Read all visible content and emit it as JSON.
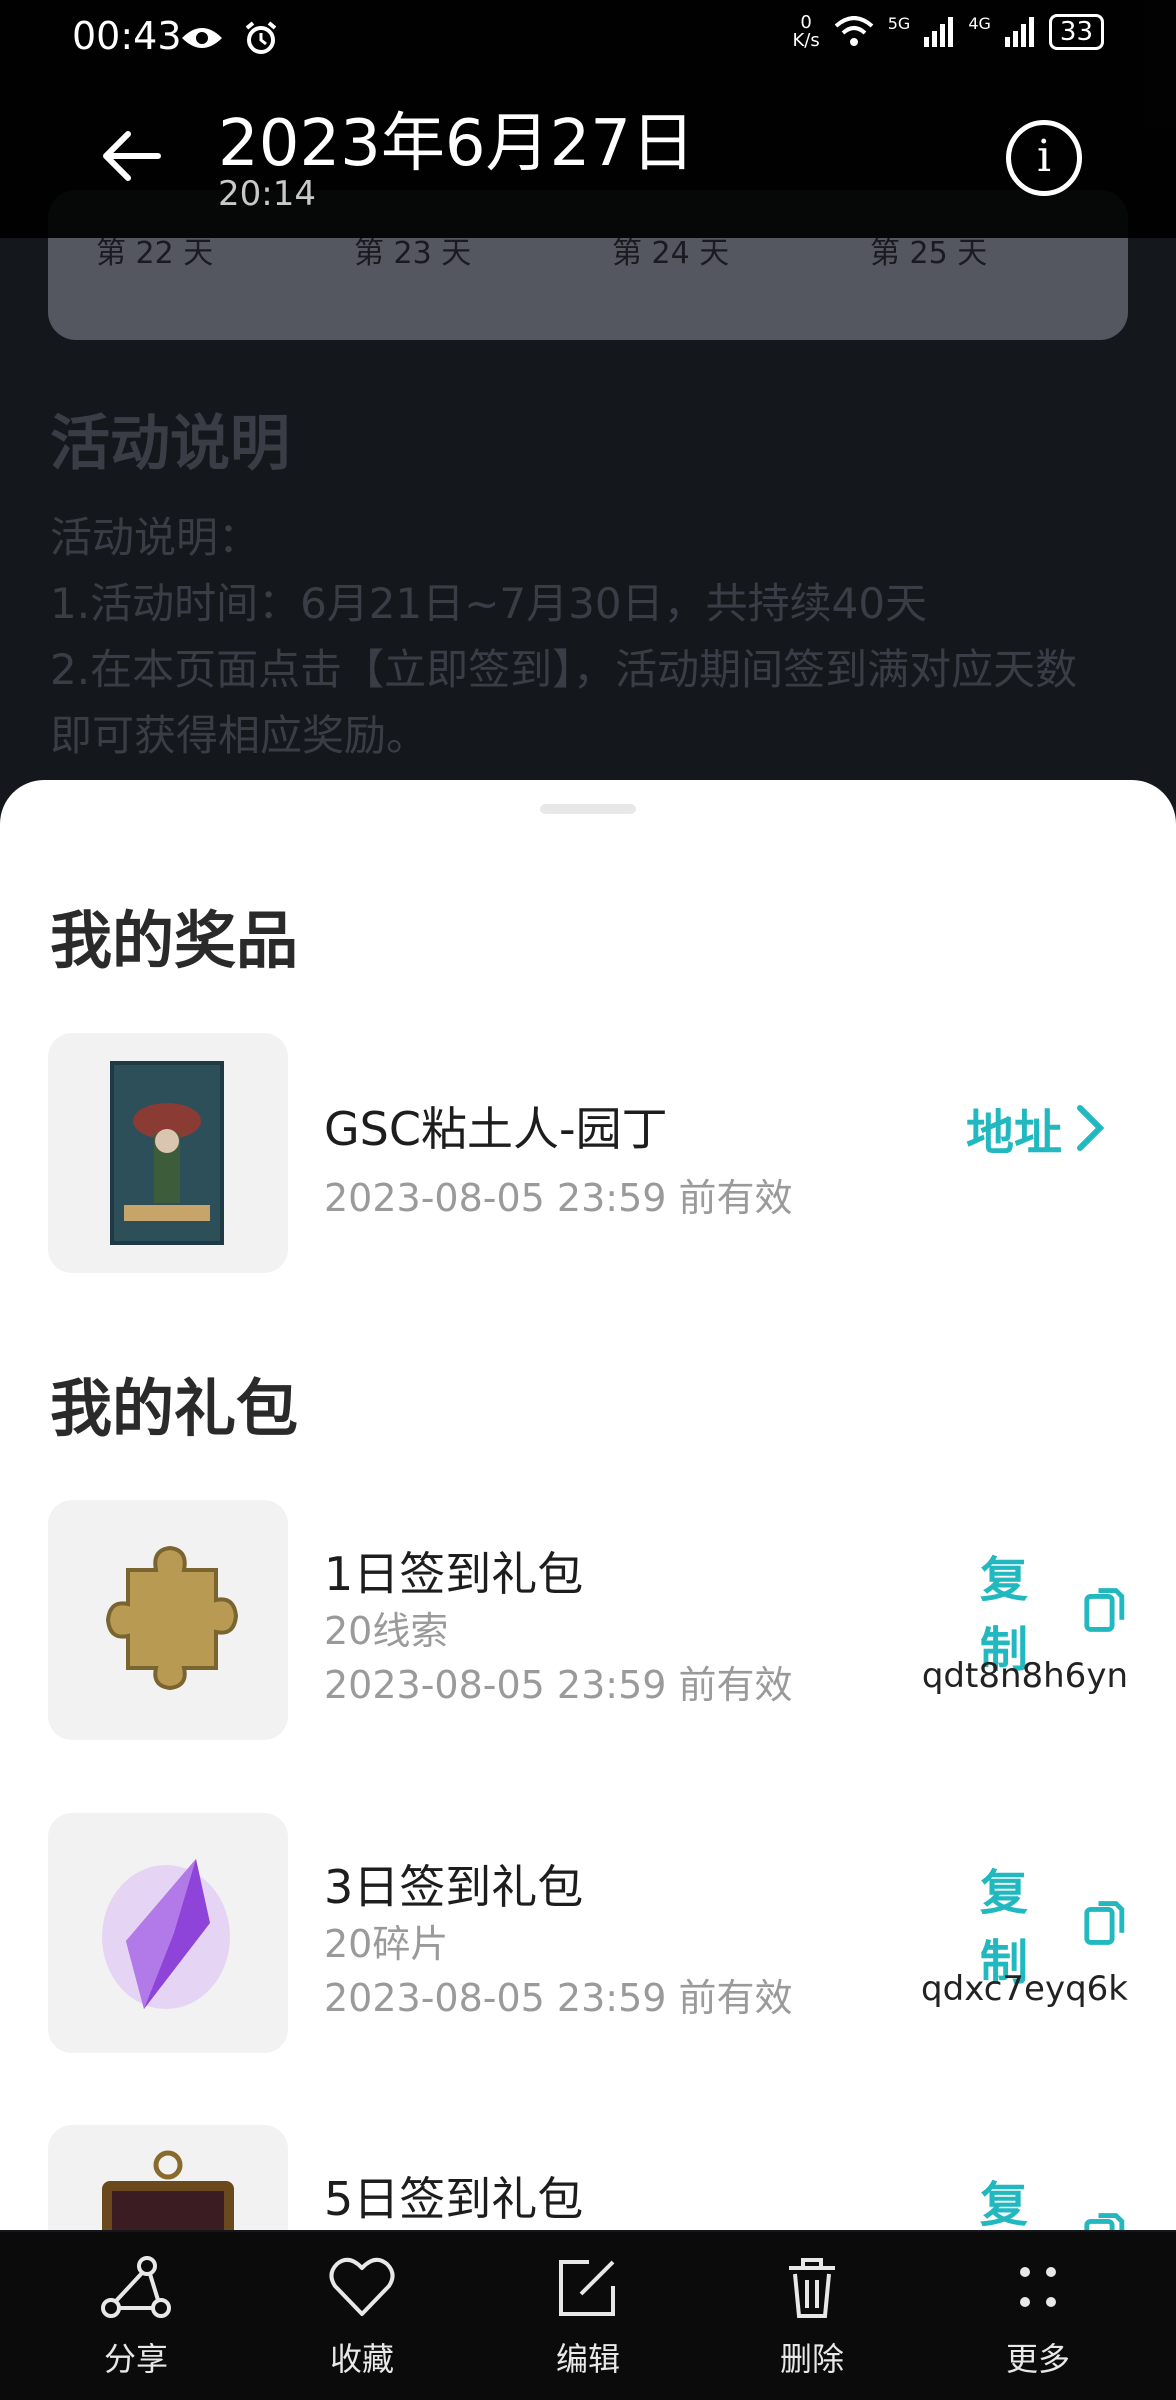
{
  "status_bar": {
    "time": "00:43",
    "speed_top": "0",
    "speed_unit": "K/s",
    "network_1": "5G",
    "network_2": "4G",
    "battery": "33"
  },
  "header": {
    "title": "2023年6月27日",
    "subtitle": "20:14"
  },
  "background_page": {
    "day_labels": [
      "第 22 天",
      "第 23 天",
      "第 24 天",
      "第 25 天"
    ],
    "section_title": "活动说明",
    "text": "活动说明：\n1.活动时间：6月21日~7月30日，共持续40天\n2.在本页面点击【立即签到】，活动期间签到满对应天数\n即可获得相应奖励。"
  },
  "sheet": {
    "prizes_title": "我的奖品",
    "prizes": [
      {
        "name": "GSC粘土人-园丁",
        "expiry": "2023-08-05  23:59  前有效",
        "action_label": "地址"
      }
    ],
    "gifts_title": "我的礼包",
    "gifts": [
      {
        "name": "1日签到礼包",
        "desc": "20线索",
        "expiry": "2023-08-05  23:59  前有效",
        "action_label": "复制",
        "code": "qdt8n8h6yn"
      },
      {
        "name": "3日签到礼包",
        "desc": "20碎片",
        "expiry": "2023-08-05  23:59  前有效",
        "action_label": "复制",
        "code": "qdxc7eyq6k"
      },
      {
        "name": "5日签到礼包",
        "desc": "",
        "expiry": "",
        "action_label": "复制",
        "code": ""
      }
    ]
  },
  "toolbar": {
    "share": "分享",
    "favorite": "收藏",
    "edit": "编辑",
    "delete": "删除",
    "more": "更多"
  },
  "colors": {
    "accent": "#22b8bf",
    "sheet_bg": "#ffffff",
    "thumb_bg": "#f2f2f2",
    "overlay": "#000000"
  }
}
